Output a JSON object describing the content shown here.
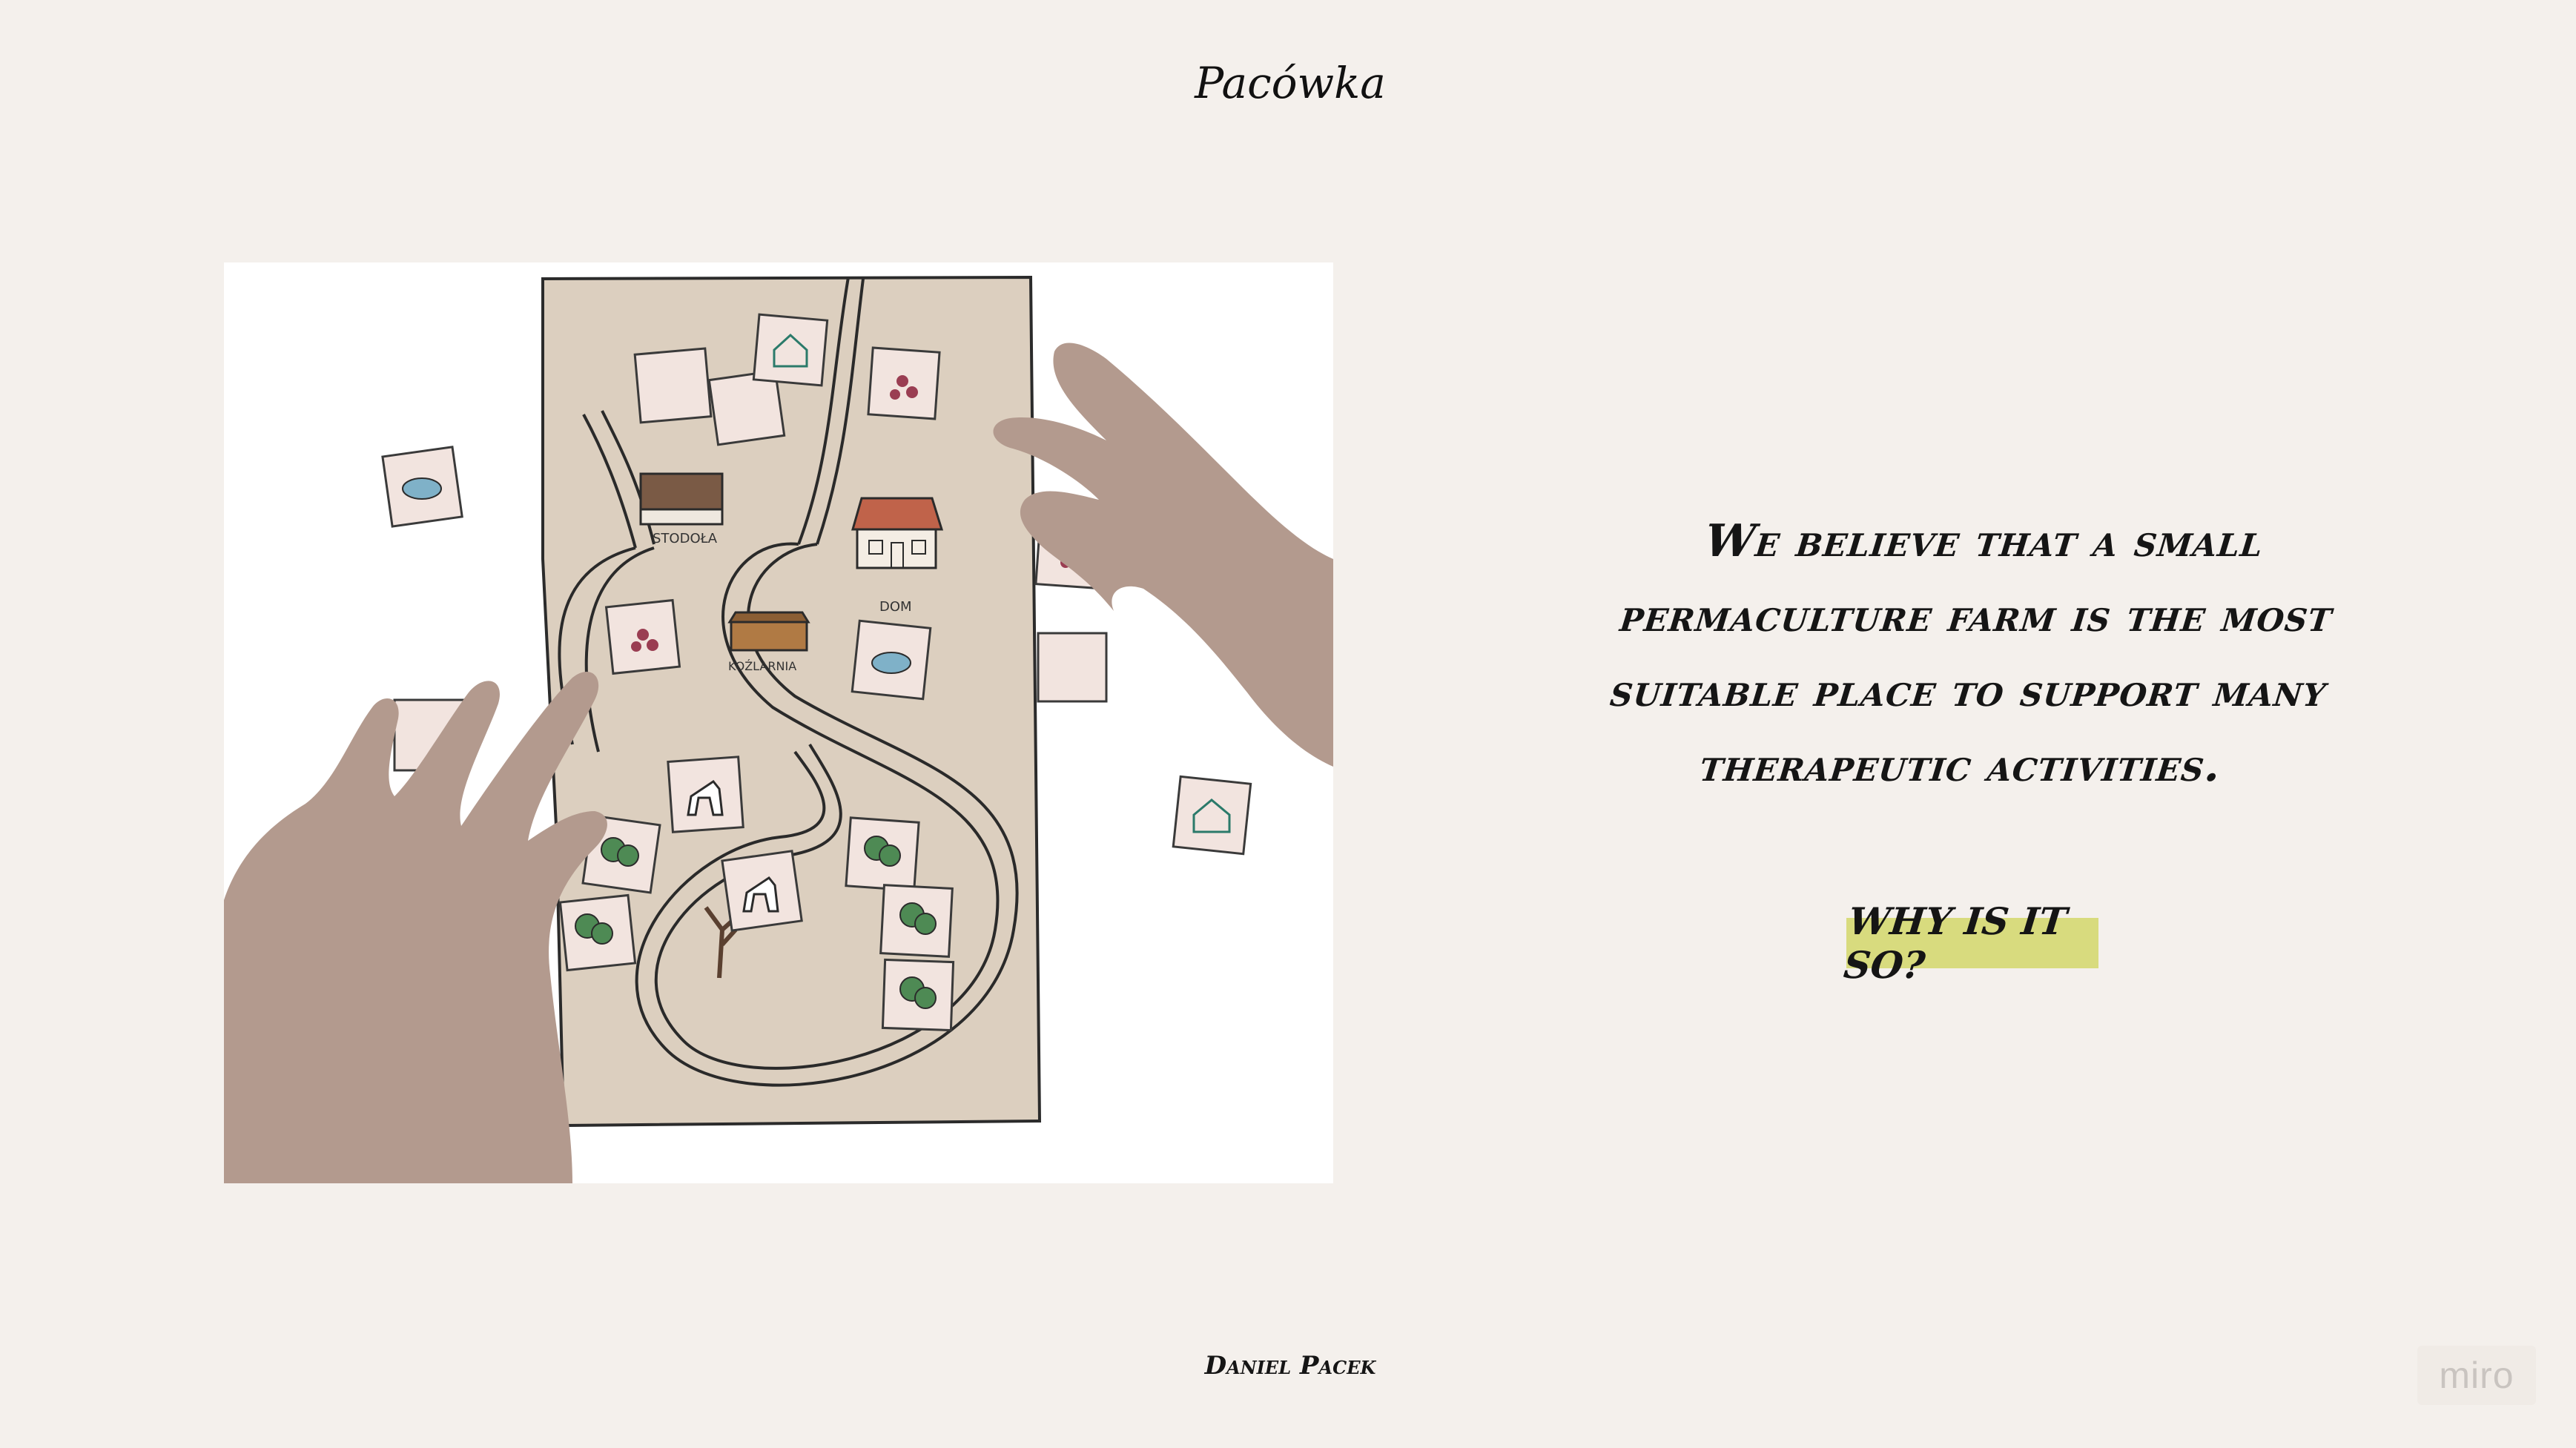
{
  "header": {
    "logo_text": "Pacówka"
  },
  "illustration": {
    "map_labels": {
      "stodola": "STODOŁA",
      "dom": "DOM",
      "kozlarnia": "KOŹLARNIA"
    }
  },
  "main": {
    "statement_lines": [
      "We believe that a small",
      "permaculture farm is the most",
      "suitable place to support many",
      "therapeutic activities."
    ],
    "cta_label": "WHY IS IT SO?"
  },
  "footer": {
    "author": "Daniel Pacek",
    "badge_label": "miro"
  },
  "colors": {
    "background": "#f4f0ec",
    "highlight": "#d8db7e",
    "paper": "#d9cbbb",
    "hand": "#b39a8e",
    "roof": "#c0634a"
  }
}
